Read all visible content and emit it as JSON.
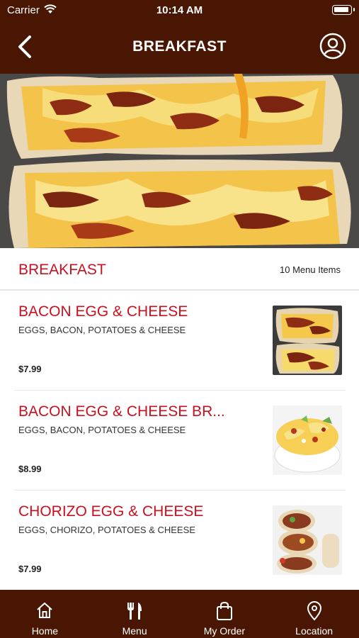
{
  "status_bar": {
    "carrier": "Carrier",
    "time": "10:14 AM"
  },
  "header": {
    "title": "BREAKFAST",
    "back_icon": "chevron-left-icon",
    "profile_icon": "user-circle-icon"
  },
  "category": {
    "name": "BREAKFAST",
    "count_label": "10 Menu Items"
  },
  "menu_items": [
    {
      "name": "BACON EGG & CHEESE",
      "description": "EGGS, BACON, POTATOES & CHEESE",
      "price": "$7.99"
    },
    {
      "name": "BACON EGG & CHEESE BR...",
      "description": "EGGS, BACON, POTATOES & CHEESE",
      "price": "$8.99"
    },
    {
      "name": "CHORIZO EGG & CHEESE",
      "description": "EGGS, CHORIZO, POTATOES & CHEESE",
      "price": "$7.99"
    }
  ],
  "tab_bar": {
    "tabs": [
      {
        "label": "Home",
        "icon": "home-icon"
      },
      {
        "label": "Menu",
        "icon": "fork-knife-icon"
      },
      {
        "label": "My Order",
        "icon": "shopping-bag-icon"
      },
      {
        "label": "Location",
        "icon": "location-pin-icon"
      }
    ]
  },
  "colors": {
    "brand_brown": "#4a1604",
    "accent_red": "#c8101e"
  }
}
